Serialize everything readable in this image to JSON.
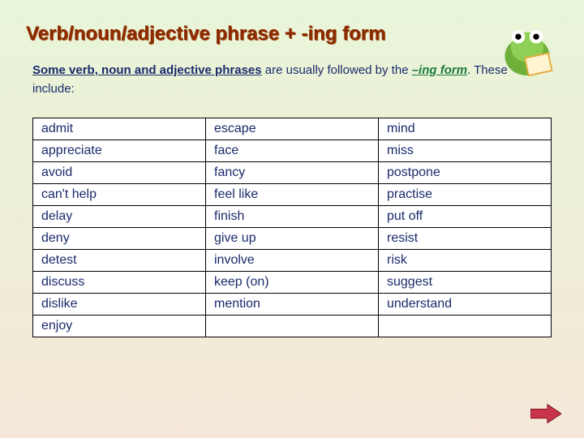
{
  "title": "Verb/noun/adjective phrase + -ing form",
  "intro": {
    "phrase_bold": "Some verb, noun and adjective phrases",
    "middle": " are usually followed by the ",
    "ing": "–ing form",
    "tail": ". These include:"
  },
  "chart_data": {
    "type": "table",
    "title": "Verbs followed by the -ing form",
    "columns": [
      "col1",
      "col2",
      "col3"
    ],
    "rows": [
      [
        "admit",
        "escape",
        "mind"
      ],
      [
        "appreciate",
        "face",
        "miss"
      ],
      [
        "avoid",
        "fancy",
        "postpone"
      ],
      [
        "can't help",
        "feel like",
        "practise"
      ],
      [
        "delay",
        "finish",
        "put off"
      ],
      [
        "deny",
        "give up",
        "resist"
      ],
      [
        "detest",
        "involve",
        "risk"
      ],
      [
        "discuss",
        "keep (on)",
        "suggest"
      ],
      [
        "dislike",
        "mention",
        "understand"
      ],
      [
        "enjoy",
        "",
        ""
      ]
    ]
  },
  "icons": {
    "frog": "frog-reading-icon",
    "arrow": "next-arrow"
  }
}
